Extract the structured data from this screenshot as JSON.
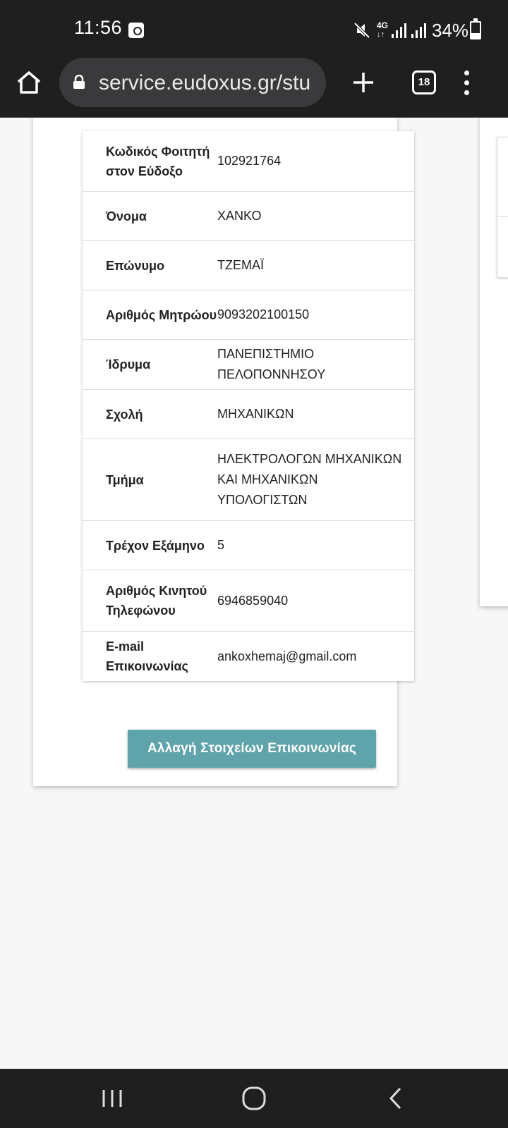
{
  "status_bar": {
    "time": "11:56",
    "network": "4G",
    "battery": "34%",
    "icons": [
      "screenshot-icon",
      "mute-icon",
      "network-4g-icon",
      "signal-icon",
      "battery-icon"
    ]
  },
  "browser": {
    "url": "service.eudoxus.gr/stu",
    "tab_count": "18",
    "icons": [
      "home-icon",
      "lock-icon",
      "add-tab-icon",
      "tabs-icon",
      "more-menu-icon"
    ]
  },
  "student_info": {
    "rows": [
      {
        "label": "Κωδικός Φοιτητή στον Εύδοξο",
        "value": "102921764"
      },
      {
        "label": "Όνομα",
        "value": "ΧΑΝΚΟ"
      },
      {
        "label": "Επώνυμο",
        "value": "ΤΖΕΜΑΪ"
      },
      {
        "label": "Αριθμός Μητρώου",
        "value": "9093202100150"
      },
      {
        "label": "Ίδρυμα",
        "value": "ΠΑΝΕΠΙΣΤΗΜΙΟ ΠΕΛΟΠΟΝΝΗΣΟΥ"
      },
      {
        "label": "Σχολή",
        "value": "ΜΗΧΑΝΙΚΩΝ"
      },
      {
        "label": "Τμήμα",
        "value": "ΗΛΕΚΤΡΟΛΟΓΩΝ ΜΗΧΑΝΙΚΩΝ ΚΑΙ ΜΗΧΑΝΙΚΩΝ ΥΠΟΛΟΓΙΣΤΩΝ"
      },
      {
        "label": "Τρέχον Εξάμηνο",
        "value": "5"
      },
      {
        "label": "Αριθμός Κινητού Τηλεφώνου",
        "value": "6946859040"
      },
      {
        "label": "E-mail Επικοινωνίας",
        "value": "ankoxhemaj@gmail.com"
      }
    ]
  },
  "actions": {
    "change_contact_label": "Αλλαγή Στοιχείων Επικοινωνίας"
  },
  "nav_bar": {
    "icons": [
      "recent-apps-icon",
      "home-nav-icon",
      "back-icon"
    ]
  },
  "colors": {
    "accent_button": "#5fa3ab",
    "system_bar": "#1f1f1f"
  }
}
